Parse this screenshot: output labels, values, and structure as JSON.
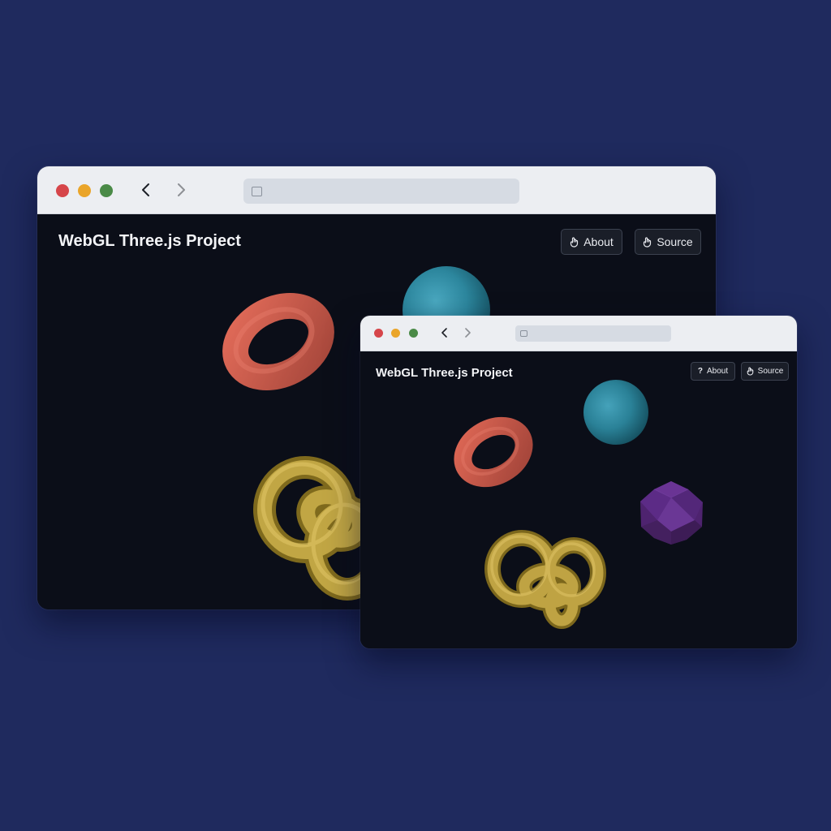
{
  "back_window": {
    "page_title": "WebGL Three.js Project",
    "buttons": {
      "about_label": "About",
      "source_label": "Source"
    },
    "icons": {
      "about": "hand-icon",
      "source": "hand-icon"
    }
  },
  "front_window": {
    "page_title": "WebGL Three.js Project",
    "buttons": {
      "about_label": "About",
      "source_label": "Source"
    },
    "icons": {
      "about": "question-icon",
      "source": "hand-icon"
    }
  },
  "scene_objects": {
    "torus": {
      "shape": "torus",
      "color": "#c9574a"
    },
    "sphere": {
      "shape": "sphere",
      "color": "#2f8ea6"
    },
    "torus_knot": {
      "shape": "torus-knot",
      "color": "#b59b3a"
    },
    "icosahedron": {
      "shape": "icosahedron",
      "color": "#5b2a86"
    }
  },
  "colors": {
    "desktop_background": "#1f2a5e",
    "canvas_background": "#0b0e18",
    "titlebar": "#eceef2"
  }
}
